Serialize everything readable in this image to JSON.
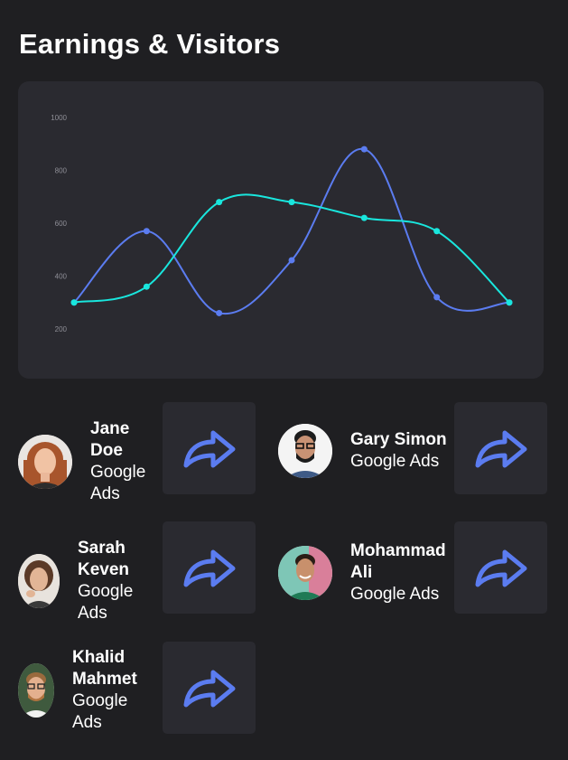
{
  "page": {
    "title": "Earnings & Visitors"
  },
  "colors": {
    "background": "#1f1f22",
    "card": "#2a2a30",
    "series_blue": "#5b7cf0",
    "series_cyan": "#19e6dd",
    "icon_blue": "#5b7cf0"
  },
  "chart_data": {
    "type": "line",
    "title": "",
    "xlabel": "",
    "ylabel": "",
    "x": [
      1,
      2,
      3,
      4,
      5,
      6,
      7
    ],
    "ylim": [
      200,
      1000
    ],
    "y_ticks": [
      "1000",
      "800",
      "600",
      "400",
      "200"
    ],
    "grid": false,
    "legend": "none",
    "series": [
      {
        "color": "#5b7cf0",
        "values": [
          300,
          570,
          260,
          460,
          880,
          320,
          300
        ]
      },
      {
        "color": "#19e6dd",
        "values": [
          300,
          360,
          680,
          680,
          620,
          570,
          300
        ]
      }
    ]
  },
  "contacts": [
    {
      "name": "Jane Doe",
      "source": "Google Ads",
      "avatar_icon": "woman-avatar-photo",
      "action_icon": "share-arrow-icon"
    },
    {
      "name": "Gary Simon",
      "source": "Google Ads",
      "avatar_icon": "man-glasses-avatar-photo",
      "action_icon": "share-arrow-icon"
    },
    {
      "name": "Sarah Keven",
      "source": "Google Ads",
      "avatar_icon": "woman-avatar-photo",
      "action_icon": "share-arrow-icon"
    },
    {
      "name": "Mohammad Ali",
      "source": "Google Ads",
      "avatar_icon": "man-avatar-photo",
      "action_icon": "share-arrow-icon"
    },
    {
      "name": "Khalid Mahmet",
      "source": "Google Ads",
      "avatar_icon": "man-beard-avatar-photo",
      "action_icon": "share-arrow-icon"
    }
  ]
}
